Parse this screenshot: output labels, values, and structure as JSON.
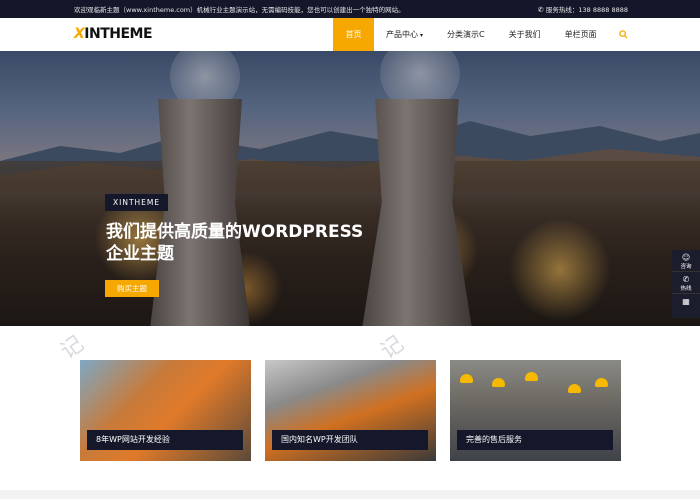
{
  "topbar": {
    "welcome": "欢迎观临新主题（www.xintheme.com）机械行业主题演示站，无需编码技能，您也可以创建出一个独特的网站。",
    "hotline": "服务热线：138 8888 8888"
  },
  "header": {
    "logo_x": "X",
    "logo_rest": "INTHEME",
    "nav": [
      {
        "label": "首页"
      },
      {
        "label": "产品中心"
      },
      {
        "label": "分类演示C"
      },
      {
        "label": "关于我们"
      },
      {
        "label": "单栏页面"
      }
    ]
  },
  "hero": {
    "tag": "XINTHEME",
    "title_line1": "我们提供高质量的WORDPRESS",
    "title_line2": "企业主题",
    "button": "购买主题"
  },
  "float": [
    {
      "label": "咨询",
      "icon": "chat-icon"
    },
    {
      "label": "热线",
      "icon": "phone-icon"
    },
    {
      "label": "",
      "icon": "qrcode-icon"
    }
  ],
  "cards": [
    {
      "caption": "8年WP网站开发经验"
    },
    {
      "caption": "国内知名WP开发团队"
    },
    {
      "caption": "完善的售后服务"
    }
  ],
  "colors": {
    "accent": "#f6a800",
    "dark": "#14162a"
  }
}
